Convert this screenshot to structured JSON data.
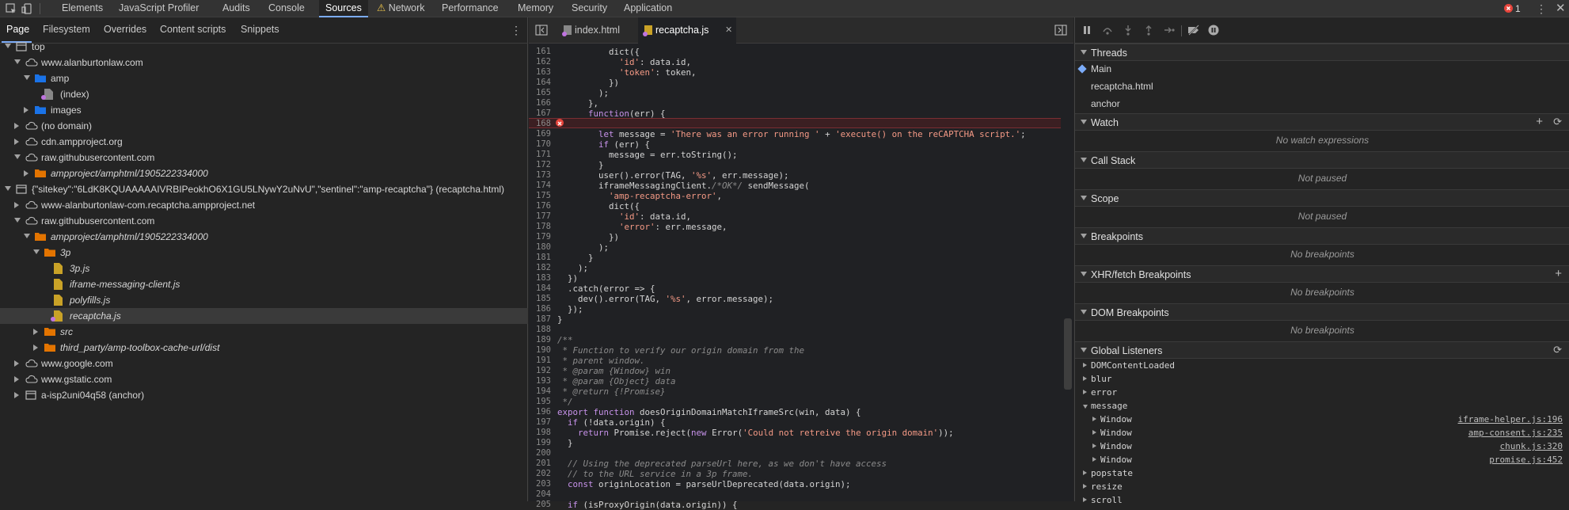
{
  "toolbar": {
    "tabs": [
      "Elements",
      "JavaScript Profiler",
      "Audits",
      "Console",
      "Sources",
      "Network",
      "Performance",
      "Memory",
      "Security",
      "Application"
    ],
    "active_tab": "Sources",
    "error_count": "1"
  },
  "navigator": {
    "tabs": [
      "Page",
      "Filesystem",
      "Overrides",
      "Content scripts",
      "Snippets"
    ],
    "active": "Page",
    "tree": [
      {
        "label": "top",
        "level": 0,
        "arrow": "down",
        "icon": "frame",
        "italic": false
      },
      {
        "label": "www.alanburtonlaw.com",
        "level": 1,
        "arrow": "down",
        "icon": "cloud",
        "italic": false
      },
      {
        "label": "amp",
        "level": 2,
        "arrow": "down",
        "icon": "folder-blue",
        "italic": false
      },
      {
        "label": "(index)",
        "level": 3,
        "arrow": "none",
        "icon": "file-gray-dot",
        "italic": false
      },
      {
        "label": "images",
        "level": 2,
        "arrow": "right",
        "icon": "folder-blue",
        "italic": false
      },
      {
        "label": "(no domain)",
        "level": 1,
        "arrow": "right",
        "icon": "cloud",
        "italic": false
      },
      {
        "label": "cdn.ampproject.org",
        "level": 1,
        "arrow": "right",
        "icon": "cloud",
        "italic": false
      },
      {
        "label": "raw.githubusercontent.com",
        "level": 1,
        "arrow": "down",
        "icon": "cloud",
        "italic": false
      },
      {
        "label": "ampproject/amphtml/1905222334000",
        "level": 2,
        "arrow": "right",
        "icon": "folder-orange",
        "italic": true
      },
      {
        "label": "{\"sitekey\":\"6LdK8KQUAAAAAIVRBIPeokhO6X1GU5LNywY2uNvU\",\"sentinel\":\"amp-recaptcha\"} (recaptcha.html)",
        "level": 0,
        "arrow": "down",
        "icon": "frame",
        "italic": false
      },
      {
        "label": "www-alanburtonlaw-com.recaptcha.ampproject.net",
        "level": 1,
        "arrow": "right",
        "icon": "cloud",
        "italic": false
      },
      {
        "label": "raw.githubusercontent.com",
        "level": 1,
        "arrow": "down",
        "icon": "cloud",
        "italic": false
      },
      {
        "label": "ampproject/amphtml/1905222334000",
        "level": 2,
        "arrow": "down",
        "icon": "folder-orange",
        "italic": true
      },
      {
        "label": "3p",
        "level": 3,
        "arrow": "down",
        "icon": "folder-orange",
        "italic": true
      },
      {
        "label": "3p.js",
        "level": 4,
        "arrow": "none",
        "icon": "file-yellow",
        "italic": true
      },
      {
        "label": "iframe-messaging-client.js",
        "level": 4,
        "arrow": "none",
        "icon": "file-yellow",
        "italic": true
      },
      {
        "label": "polyfills.js",
        "level": 4,
        "arrow": "none",
        "icon": "file-yellow",
        "italic": true
      },
      {
        "label": "recaptcha.js",
        "level": 4,
        "arrow": "none",
        "icon": "file-yellow-dot",
        "italic": true,
        "selected": true
      },
      {
        "label": "src",
        "level": 3,
        "arrow": "right",
        "icon": "folder-orange",
        "italic": true
      },
      {
        "label": "third_party/amp-toolbox-cache-url/dist",
        "level": 3,
        "arrow": "right",
        "icon": "folder-orange",
        "italic": true
      },
      {
        "label": "www.google.com",
        "level": 1,
        "arrow": "right",
        "icon": "cloud",
        "italic": false
      },
      {
        "label": "www.gstatic.com",
        "level": 1,
        "arrow": "right",
        "icon": "cloud",
        "italic": false
      },
      {
        "label": "a-isp2uni04q58 (anchor)",
        "level": 1,
        "arrow": "right",
        "icon": "frame",
        "italic": false
      }
    ]
  },
  "editor": {
    "tabs": [
      {
        "label": "index.html",
        "active": false
      },
      {
        "label": "recaptcha.js",
        "active": true
      }
    ],
    "error_line": 168,
    "lines": [
      {
        "n": "161",
        "code": "          dict({"
      },
      {
        "n": "162",
        "code": "            'id': data.id,"
      },
      {
        "n": "163",
        "code": "            'token': token,"
      },
      {
        "n": "164",
        "code": "          })"
      },
      {
        "n": "165",
        "code": "        );"
      },
      {
        "n": "166",
        "code": "      },"
      },
      {
        "n": "167",
        "code": "      function(err) {"
      },
      {
        "n": "168",
        "code": ""
      },
      {
        "n": "169",
        "code": "        let message = 'There was an error running ' + 'execute() on the reCAPTCHA script.';"
      },
      {
        "n": "170",
        "code": "        if (err) {"
      },
      {
        "n": "171",
        "code": "          message = err.toString();"
      },
      {
        "n": "172",
        "code": "        }"
      },
      {
        "n": "173",
        "code": "        user().error(TAG, '%s', err.message);"
      },
      {
        "n": "174",
        "code": "        iframeMessagingClient./*OK*/ sendMessage("
      },
      {
        "n": "175",
        "code": "          'amp-recaptcha-error',"
      },
      {
        "n": "176",
        "code": "          dict({"
      },
      {
        "n": "177",
        "code": "            'id': data.id,"
      },
      {
        "n": "178",
        "code": "            'error': err.message,"
      },
      {
        "n": "179",
        "code": "          })"
      },
      {
        "n": "180",
        "code": "        );"
      },
      {
        "n": "181",
        "code": "      }"
      },
      {
        "n": "182",
        "code": "    );"
      },
      {
        "n": "183",
        "code": "  })"
      },
      {
        "n": "184",
        "code": "  .catch(error => {"
      },
      {
        "n": "185",
        "code": "    dev().error(TAG, '%s', error.message);"
      },
      {
        "n": "186",
        "code": "  });"
      },
      {
        "n": "187",
        "code": "}"
      },
      {
        "n": "188",
        "code": ""
      },
      {
        "n": "189",
        "code": "/**"
      },
      {
        "n": "190",
        "code": " * Function to verify our origin domain from the"
      },
      {
        "n": "191",
        "code": " * parent window."
      },
      {
        "n": "192",
        "code": " * @param {Window} win"
      },
      {
        "n": "193",
        "code": " * @param {Object} data"
      },
      {
        "n": "194",
        "code": " * @return {!Promise}"
      },
      {
        "n": "195",
        "code": " */"
      },
      {
        "n": "196",
        "code": "export function doesOriginDomainMatchIframeSrc(win, data) {"
      },
      {
        "n": "197",
        "code": "  if (!data.origin) {"
      },
      {
        "n": "198",
        "code": "    return Promise.reject(new Error('Could not retreive the origin domain'));"
      },
      {
        "n": "199",
        "code": "  }"
      },
      {
        "n": "200",
        "code": ""
      },
      {
        "n": "201",
        "code": "  // Using the deprecated parseUrl here, as we don't have access"
      },
      {
        "n": "202",
        "code": "  // to the URL service in a 3p frame."
      },
      {
        "n": "203",
        "code": "  const originLocation = parseUrlDeprecated(data.origin);"
      },
      {
        "n": "204",
        "code": ""
      },
      {
        "n": "205",
        "code": "  if (isProxyOrigin(data.origin)) {"
      }
    ]
  },
  "debugger": {
    "sections": {
      "threads": {
        "title": "Threads",
        "items": [
          "Main",
          "recaptcha.html",
          "anchor"
        ]
      },
      "watch": {
        "title": "Watch",
        "empty": "No watch expressions"
      },
      "call_stack": {
        "title": "Call Stack",
        "empty": "Not paused"
      },
      "scope": {
        "title": "Scope",
        "empty": "Not paused"
      },
      "breakpoints": {
        "title": "Breakpoints",
        "empty": "No breakpoints"
      },
      "xhr": {
        "title": "XHR/fetch Breakpoints",
        "empty": "No breakpoints"
      },
      "dom": {
        "title": "DOM Breakpoints",
        "empty": "No breakpoints"
      },
      "global": {
        "title": "Global Listeners"
      }
    },
    "listeners": [
      {
        "label": "DOMContentLoaded",
        "level": 0,
        "arrow": "right",
        "link": ""
      },
      {
        "label": "blur",
        "level": 0,
        "arrow": "right",
        "link": ""
      },
      {
        "label": "error",
        "level": 0,
        "arrow": "right",
        "link": ""
      },
      {
        "label": "message",
        "level": 0,
        "arrow": "down",
        "link": ""
      },
      {
        "label": "Window",
        "level": 1,
        "arrow": "right",
        "link": "iframe-helper.js:196"
      },
      {
        "label": "Window",
        "level": 1,
        "arrow": "right",
        "link": "amp-consent.js:235"
      },
      {
        "label": "Window",
        "level": 1,
        "arrow": "right",
        "link": "chunk.js:320"
      },
      {
        "label": "Window",
        "level": 1,
        "arrow": "right",
        "link": "promise.js:452"
      },
      {
        "label": "popstate",
        "level": 0,
        "arrow": "right",
        "link": ""
      },
      {
        "label": "resize",
        "level": 0,
        "arrow": "right",
        "link": ""
      },
      {
        "label": "scroll",
        "level": 0,
        "arrow": "right",
        "link": ""
      }
    ]
  },
  "colors": {
    "accent": "#7cacf8",
    "error": "#e8453c",
    "folder_blue": "#1a73e8",
    "folder_orange": "#e37400",
    "file_yellow": "#c9a227"
  }
}
